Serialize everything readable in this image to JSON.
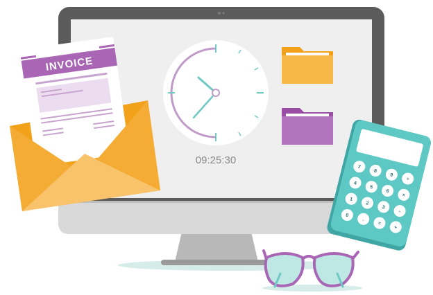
{
  "clock": {
    "time": "09:25:30"
  },
  "invoice": {
    "title": "INVOICE"
  },
  "calculator": {
    "keys": [
      "7",
      "8",
      "9",
      "÷",
      "4",
      "5",
      "6",
      "×",
      "1",
      "2",
      "3",
      "-",
      "0",
      ".",
      "=",
      "+"
    ]
  },
  "colors": {
    "monitor_frame": "#5b5b5b",
    "screen": "#efefef",
    "accent_purple": "#a866b4",
    "accent_orange": "#f7a830",
    "accent_teal": "#5ec8c4",
    "clock_hand": "#6fc9c4"
  },
  "icons": [
    "monitor",
    "clock-icon",
    "folder-icon",
    "envelope-icon",
    "invoice-icon",
    "calculator-icon",
    "glasses-icon"
  ]
}
